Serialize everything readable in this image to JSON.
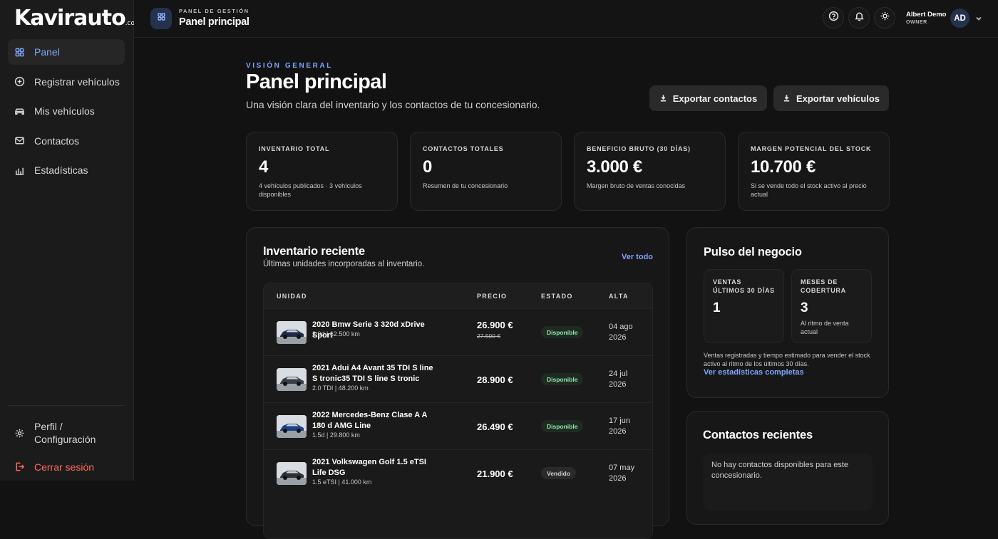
{
  "brand": {
    "logo": "Kavirauto",
    "logo_suffix": ".com"
  },
  "sidebar": {
    "items": [
      {
        "label": "Panel",
        "icon": "grid-icon",
        "active": true
      },
      {
        "label": "Registrar vehículos",
        "icon": "plus-circle-icon"
      },
      {
        "label": "Mis vehículos",
        "icon": "car-icon"
      },
      {
        "label": "Contactos",
        "icon": "mail-icon"
      },
      {
        "label": "Estadísticas",
        "icon": "bar-chart-icon"
      }
    ],
    "bottom": [
      {
        "label": "Perfil / Configuración",
        "icon": "gear-icon"
      },
      {
        "label": "Cerrar sesión",
        "icon": "logout-icon"
      }
    ]
  },
  "topbar": {
    "kicker": "PANEL DE GESTIÓN",
    "title": "Panel principal",
    "user_name": "Albert Demo",
    "user_role": "OWNER",
    "avatar": "AD"
  },
  "header": {
    "kicker": "VISIÓN GENERAL",
    "title": "Panel principal",
    "subtitle": "Una visión clara del inventario y los contactos de tu concesionario.",
    "export_contacts": "Exportar contactos",
    "export_vehicles": "Exportar vehículos"
  },
  "stats": [
    {
      "label": "INVENTARIO TOTAL",
      "value": "4",
      "note": "4 vehículos publicados · 3 vehículos disponibles"
    },
    {
      "label": "CONTACTOS TOTALES",
      "value": "0",
      "note": "Resumen de tu concesionario"
    },
    {
      "label": "BENEFICIO BRUTO (30 DÍAS)",
      "value": "3.000 €",
      "note": "Margen bruto de ventas conocidas"
    },
    {
      "label": "MARGEN POTENCIAL DEL STOCK",
      "value": "10.700 €",
      "note": "Si se vende todo el stock activo al precio actual"
    }
  ],
  "inventory": {
    "title": "Inventario reciente",
    "subtitle": "Últimas unidades incorporadas al inventario.",
    "see_all": "Ver todo",
    "columns": [
      "UNIDAD",
      "PRECIO",
      "ESTADO",
      "ALTA"
    ],
    "rows": [
      {
        "name": "2020 Bmw Serie 3 320d xDrive Sport",
        "meta": "2.0d | 62.500 km",
        "price": "26.900 €",
        "old_price": "27.500 €",
        "status": "Disponible",
        "date": "04 ago 2026",
        "car_color": "#1e2a44"
      },
      {
        "name": "2021 Adui A4 Avant 35 TDI S line S tronic35 TDI S line S tronic",
        "meta": "2.0 TDI | 48.200 km",
        "price": "28.900 €",
        "old_price": "",
        "status": "Disponible",
        "date": "24 jul 2026",
        "car_color": "#3a3f47"
      },
      {
        "name": "2022 Mercedes-Benz Clase A A 180 d AMG Line",
        "meta": "1.5d | 29.800 km",
        "price": "26.490 €",
        "old_price": "",
        "status": "Disponible",
        "date": "17 jun 2026",
        "car_color": "#1f3f86"
      },
      {
        "name": "2021 Volkswagen Golf 1.5 eTSI Life DSG",
        "meta": "1.5 eTSI | 41.000 km",
        "price": "21.900 €",
        "old_price": "",
        "status": "Vendido",
        "date": "07 may 2026",
        "car_color": "#2e3136"
      }
    ]
  },
  "pulse": {
    "title": "Pulso del negocio",
    "metrics": [
      {
        "label": "VENTAS ÚLTIMOS 30 DÍAS",
        "value": "1",
        "note": ""
      },
      {
        "label": "MESES DE COBERTURA",
        "value": "3",
        "note": "Al ritmo de venta actual"
      }
    ],
    "description": "Ventas registradas y tiempo estimado para vender el stock activo al ritmo de los últimos 30 días.",
    "link": "Ver estadísticas completas"
  },
  "contacts": {
    "title": "Contactos recientes",
    "empty": "No hay contactos disponibles para este concesionario."
  },
  "colors": {
    "accent": "#7ea6ff",
    "available": "#8ee8a8",
    "danger": "#ff6b5e"
  }
}
